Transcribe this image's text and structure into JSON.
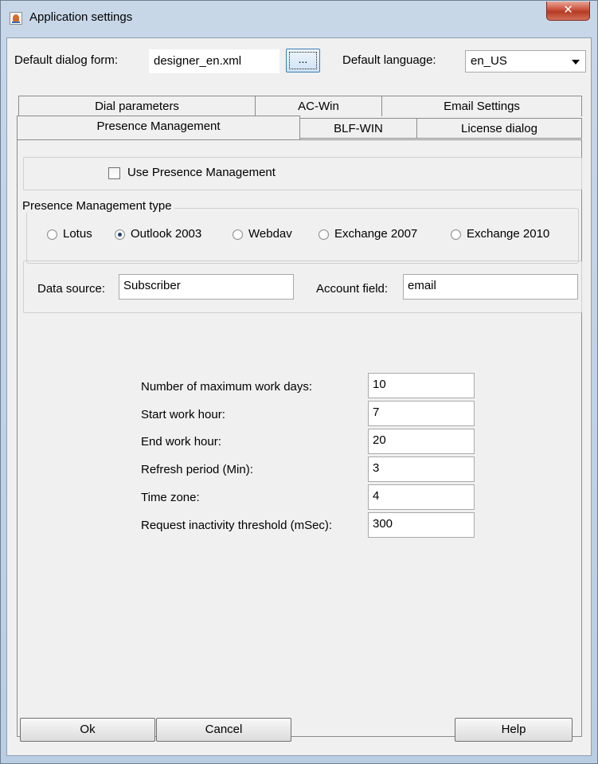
{
  "window": {
    "title": "Application settings",
    "close_glyph": "✕",
    "title_icon": "java-app-icon"
  },
  "top": {
    "dialog_form_label": "Default dialog form:",
    "dialog_form_value": "designer_en.xml",
    "browse_label": "...",
    "language_label": "Default language:",
    "language_value": "en_US"
  },
  "tabs": {
    "row1": [
      "Dial parameters",
      "AC-Win",
      "Email Settings"
    ],
    "row2": [
      "Presence Management",
      "BLF-WIN",
      "License dialog"
    ],
    "selected": "Presence Management"
  },
  "presence": {
    "use_label": "Use Presence Management",
    "use_checked": false,
    "type_group_title": "Presence Management type",
    "types": [
      {
        "label": "Lotus",
        "checked": false
      },
      {
        "label": "Outlook 2003",
        "checked": true
      },
      {
        "label": "Webdav",
        "checked": false
      },
      {
        "label": "Exchange 2007",
        "checked": false
      },
      {
        "label": "Exchange 2010",
        "checked": false
      }
    ],
    "data_source_label": "Data source:",
    "data_source_value": "Subscriber",
    "account_field_label": "Account field:",
    "account_field_value": "email"
  },
  "settings": {
    "rows": [
      {
        "label": "Number of maximum work days:",
        "value": "10"
      },
      {
        "label": "Start work hour:",
        "value": "7"
      },
      {
        "label": "End work hour:",
        "value": "20"
      },
      {
        "label": "Refresh period (Min):",
        "value": "3"
      },
      {
        "label": "Time zone:",
        "value": "4"
      },
      {
        "label": "Request inactivity threshold (mSec):",
        "value": "300"
      }
    ]
  },
  "buttons": {
    "ok": "Ok",
    "cancel": "Cancel",
    "help": "Help"
  }
}
